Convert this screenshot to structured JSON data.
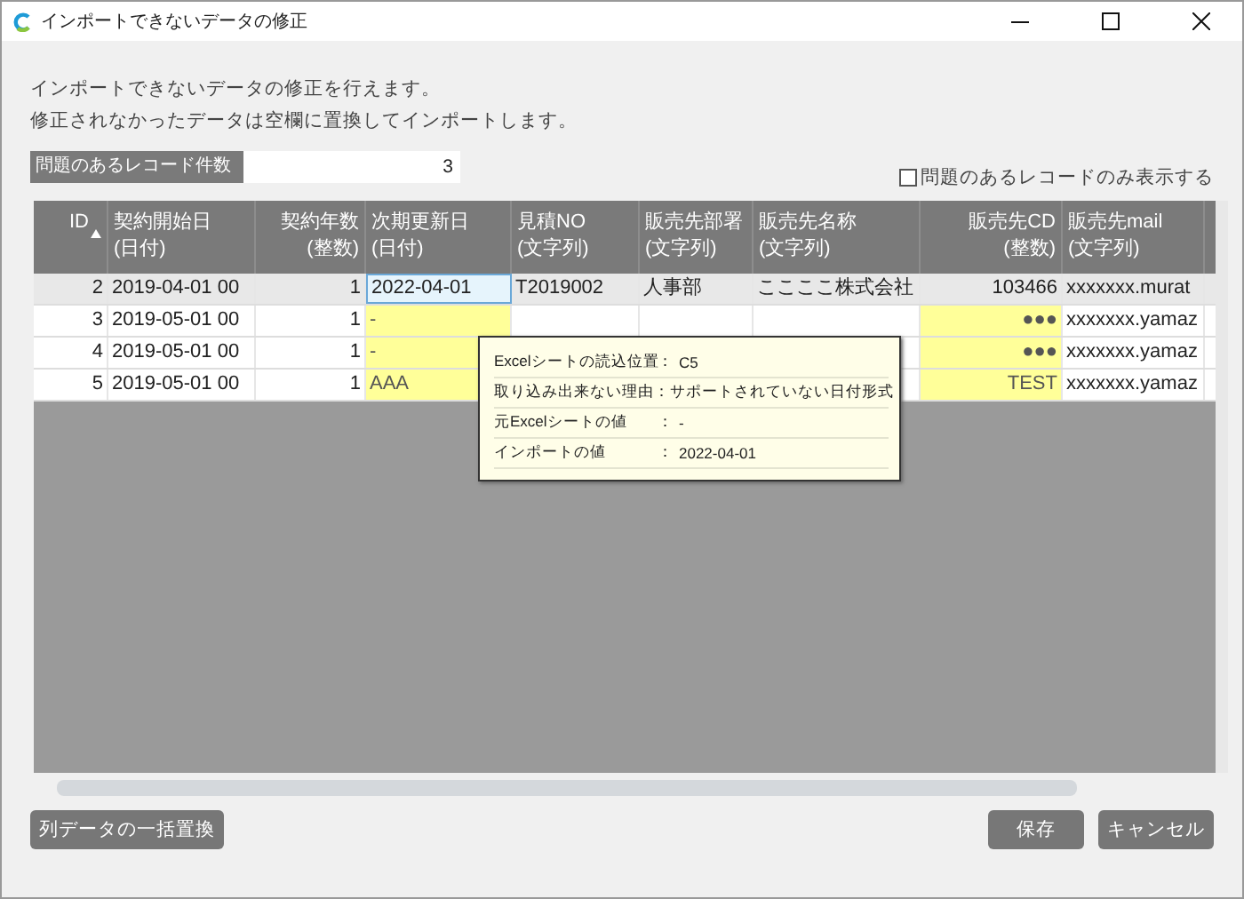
{
  "window": {
    "title": "インポートできないデータの修正"
  },
  "intro": [
    "インポートできないデータの修正を行えます。",
    "修正されなかったデータは空欄に置換してインポートします。"
  ],
  "count": {
    "label": "問題のあるレコード件数",
    "value": "3"
  },
  "filter": {
    "label": "問題のあるレコードのみ表示する",
    "checked": false
  },
  "table": {
    "columns": [
      {
        "label": "ID",
        "sorted": true
      },
      {
        "label": "契約開始日",
        "sub": "(日付)"
      },
      {
        "label": "契約年数",
        "sub": "(整数)"
      },
      {
        "label": "次期更新日",
        "sub": "(日付)"
      },
      {
        "label": "見積NO",
        "sub": "(文字列)"
      },
      {
        "label": "販売先部署",
        "sub": "(文字列)"
      },
      {
        "label": "販売先名称",
        "sub": "(文字列)"
      },
      {
        "label": "販売先CD",
        "sub": "(整数)"
      },
      {
        "label": "販売先mail",
        "sub": "(文字列)"
      }
    ],
    "rows": [
      {
        "selected": true,
        "cells": [
          {
            "text": "2"
          },
          {
            "text": "2019-04-01 00"
          },
          {
            "text": "1"
          },
          {
            "text": "2022-04-01",
            "editing": true
          },
          {
            "text": "T2019002"
          },
          {
            "text": "人事部"
          },
          {
            "text": "ここここ株式会社"
          },
          {
            "text": "103466"
          },
          {
            "text": "xxxxxxx.murat"
          }
        ]
      },
      {
        "selected": false,
        "cells": [
          {
            "text": "3"
          },
          {
            "text": "2019-05-01 00"
          },
          {
            "text": "1"
          },
          {
            "text": "-",
            "error": true
          },
          {},
          {},
          {},
          {
            "text": "●●●",
            "error": true
          },
          {
            "text": "xxxxxxx.yamaz"
          }
        ]
      },
      {
        "selected": false,
        "cells": [
          {
            "text": "4"
          },
          {
            "text": "2019-05-01 00"
          },
          {
            "text": "1"
          },
          {
            "text": "-",
            "error": true
          },
          {},
          {},
          {},
          {
            "text": "●●●",
            "error": true
          },
          {
            "text": "xxxxxxx.yamaz"
          }
        ]
      },
      {
        "selected": false,
        "cells": [
          {
            "text": "5"
          },
          {
            "text": "2019-05-01 00"
          },
          {
            "text": "1"
          },
          {
            "text": "AAA",
            "error": true
          },
          {},
          {},
          {},
          {
            "text": "TEST",
            "error": true
          },
          {
            "text": "xxxxxxx.yamaz"
          }
        ]
      }
    ]
  },
  "tooltip": [
    {
      "label": "Excelシートの読込位置",
      "separator": "：",
      "value": "C5"
    },
    {
      "label": "取り込み出来ない理由",
      "separator": "：",
      "value": "サポートされていない日付形式"
    },
    {
      "label": "元Excelシートの値",
      "separator": "：",
      "value": "-"
    },
    {
      "label": "インポートの値",
      "separator": "：",
      "value": "2022-04-01"
    }
  ],
  "buttons": {
    "left": [
      "列データの一括置換"
    ],
    "right": [
      "保存",
      "キャンセル"
    ]
  }
}
